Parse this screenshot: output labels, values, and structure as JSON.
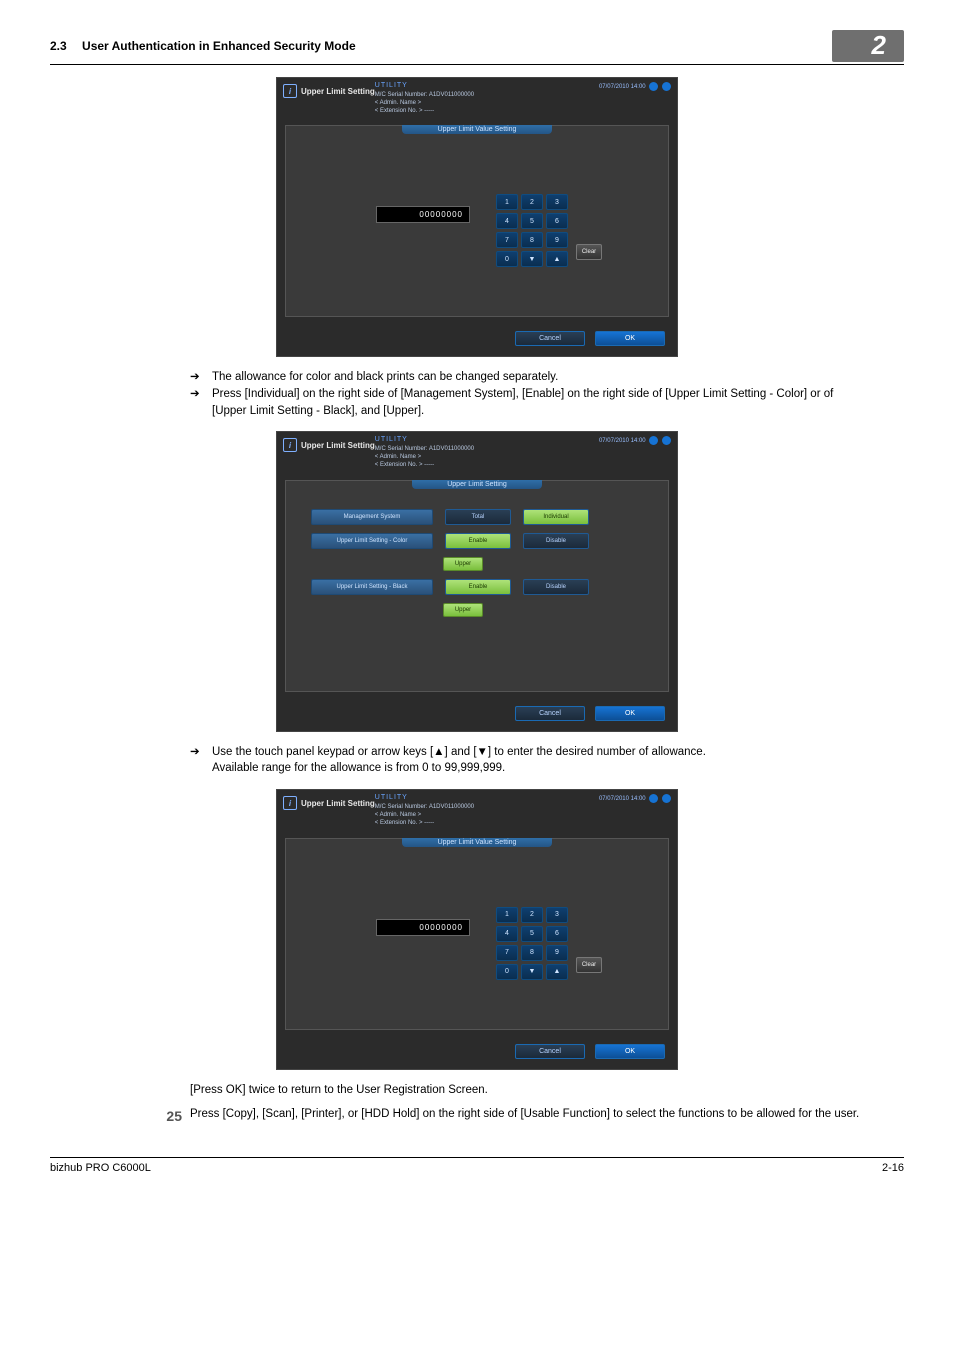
{
  "header": {
    "section_number": "2.3",
    "section_title": "User Authentication in Enhanced Security Mode",
    "chapter": "2"
  },
  "shot_common": {
    "utility": "UTILITY",
    "datetime": "07/07/2010 14:00",
    "title_label": "Upper Limit Setting",
    "serial_label": "M/C Serial Number:",
    "serial_value": "A1DV011000000",
    "admin_label": "< Admin. Name >",
    "ext_label": "< Extension No. >",
    "ext_value": "-----",
    "cancel": "Cancel",
    "ok": "OK",
    "clear": "Clear"
  },
  "shot_value_title": "Upper Limit Value Setting",
  "shot_list_title": "Upper Limit Setting",
  "value": "00000000",
  "keypad": [
    "1",
    "2",
    "3",
    "4",
    "5",
    "6",
    "7",
    "8",
    "9",
    "0",
    "▼",
    "▲"
  ],
  "settings": {
    "mgmt_label": "Management System",
    "total": "Total",
    "individual": "Individual",
    "color_label": "Upper Limit Setting - Color",
    "black_label": "Upper Limit Setting - Black",
    "enable": "Enable",
    "disable": "Disable",
    "upper": "Upper"
  },
  "text": {
    "b1": "The allowance for color and black prints can be changed separately.",
    "b2": "Press [Individual] on the right side of [Management System], [Enable] on the right side of [Upper Limit Setting - Color] or of [Upper Limit Setting - Black], and [Upper].",
    "b3a": "Use the touch panel keypad or arrow keys [▲] and [▼] to enter the desired number of allowance.",
    "b3b": "Available range for the allowance is from 0 to 99,999,999.",
    "press_ok": "[Press OK] twice to return to the User Registration Screen.",
    "step25": "Press [Copy], [Scan], [Printer], or [HDD Hold] on the right side of [Usable Function] to select the functions to be allowed for the user.",
    "step_num": "25"
  },
  "footer": {
    "left": "bizhub PRO C6000L",
    "right": "2-16"
  }
}
